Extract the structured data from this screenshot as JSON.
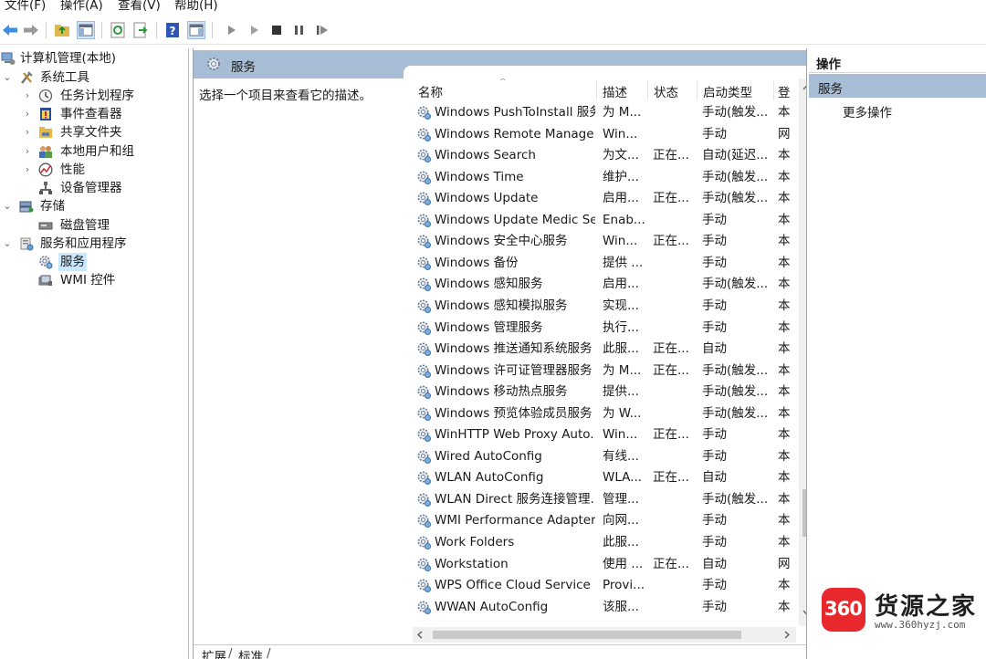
{
  "menu": [
    "文件(F)",
    "操作(A)",
    "查看(V)",
    "帮助(H)"
  ],
  "tree": {
    "root": "计算机管理(本地)",
    "system_tools": "系统工具",
    "task_scheduler": "任务计划程序",
    "event_viewer": "事件查看器",
    "shared_folders": "共享文件夹",
    "local_users": "本地用户和组",
    "performance": "性能",
    "device_manager": "设备管理器",
    "storage": "存储",
    "disk_management": "磁盘管理",
    "services_apps": "服务和应用程序",
    "services": "服务",
    "wmi": "WMI 控件"
  },
  "center": {
    "title": "服务",
    "description_hint": "选择一个项目来查看它的描述。",
    "columns": {
      "name": "名称",
      "desc": "描述",
      "status": "状态",
      "startup": "启动类型",
      "logon": "登"
    },
    "rows": [
      {
        "name": "Windows PushToInstall 服务",
        "desc": "为 M...",
        "status": "",
        "startup": "手动(触发...",
        "logon": "本"
      },
      {
        "name": "Windows Remote Manage...",
        "desc": "Win...",
        "status": "",
        "startup": "手动",
        "logon": "网"
      },
      {
        "name": "Windows Search",
        "desc": "为文...",
        "status": "正在...",
        "startup": "自动(延迟...",
        "logon": "本"
      },
      {
        "name": "Windows Time",
        "desc": "维护...",
        "status": "",
        "startup": "手动(触发...",
        "logon": "本"
      },
      {
        "name": "Windows Update",
        "desc": "启用...",
        "status": "正在...",
        "startup": "手动(触发...",
        "logon": "本"
      },
      {
        "name": "Windows Update Medic Se...",
        "desc": "Enab...",
        "status": "",
        "startup": "手动",
        "logon": "本"
      },
      {
        "name": "Windows 安全中心服务",
        "desc": "Win...",
        "status": "正在...",
        "startup": "手动",
        "logon": "本"
      },
      {
        "name": "Windows 备份",
        "desc": "提供 ...",
        "status": "",
        "startup": "手动",
        "logon": "本"
      },
      {
        "name": "Windows 感知服务",
        "desc": "启用...",
        "status": "",
        "startup": "手动(触发...",
        "logon": "本"
      },
      {
        "name": "Windows 感知模拟服务",
        "desc": "实现...",
        "status": "",
        "startup": "手动",
        "logon": "本"
      },
      {
        "name": "Windows 管理服务",
        "desc": "执行...",
        "status": "",
        "startup": "手动",
        "logon": "本"
      },
      {
        "name": "Windows 推送通知系统服务",
        "desc": "此服...",
        "status": "正在...",
        "startup": "自动",
        "logon": "本"
      },
      {
        "name": "Windows 许可证管理器服务",
        "desc": "为 M...",
        "status": "正在...",
        "startup": "手动(触发...",
        "logon": "本"
      },
      {
        "name": "Windows 移动热点服务",
        "desc": "提供...",
        "status": "",
        "startup": "手动(触发...",
        "logon": "本"
      },
      {
        "name": "Windows 预览体验成员服务",
        "desc": "为 W...",
        "status": "",
        "startup": "手动(触发...",
        "logon": "本"
      },
      {
        "name": "WinHTTP Web Proxy Auto...",
        "desc": "Win...",
        "status": "正在...",
        "startup": "手动",
        "logon": "本"
      },
      {
        "name": "Wired AutoConfig",
        "desc": "有线...",
        "status": "",
        "startup": "手动",
        "logon": "本"
      },
      {
        "name": "WLAN AutoConfig",
        "desc": "WLA...",
        "status": "正在...",
        "startup": "自动",
        "logon": "本"
      },
      {
        "name": "WLAN Direct 服务连接管理...",
        "desc": "管理...",
        "status": "",
        "startup": "手动(触发...",
        "logon": "本"
      },
      {
        "name": "WMI Performance Adapter",
        "desc": "向网...",
        "status": "",
        "startup": "手动",
        "logon": "本"
      },
      {
        "name": "Work Folders",
        "desc": "此服...",
        "status": "",
        "startup": "手动",
        "logon": "本"
      },
      {
        "name": "Workstation",
        "desc": "使用 ...",
        "status": "正在...",
        "startup": "自动",
        "logon": "网"
      },
      {
        "name": "WPS Office Cloud Service",
        "desc": "Provi...",
        "status": "",
        "startup": "手动",
        "logon": "本"
      },
      {
        "name": "WWAN AutoConfig",
        "desc": "该服...",
        "status": "",
        "startup": "手动",
        "logon": "本"
      }
    ],
    "tabs": [
      "扩展",
      "标准"
    ]
  },
  "actions": {
    "header": "操作",
    "section": "服务",
    "more": "更多操作"
  },
  "watermark": {
    "badge": "360",
    "brand": "货源之家",
    "url": "www.360hyzj.com"
  },
  "colors": {
    "pane_header": "#a7bdd5",
    "selection": "#cce8ff",
    "watermark_red": "#e8282d"
  }
}
